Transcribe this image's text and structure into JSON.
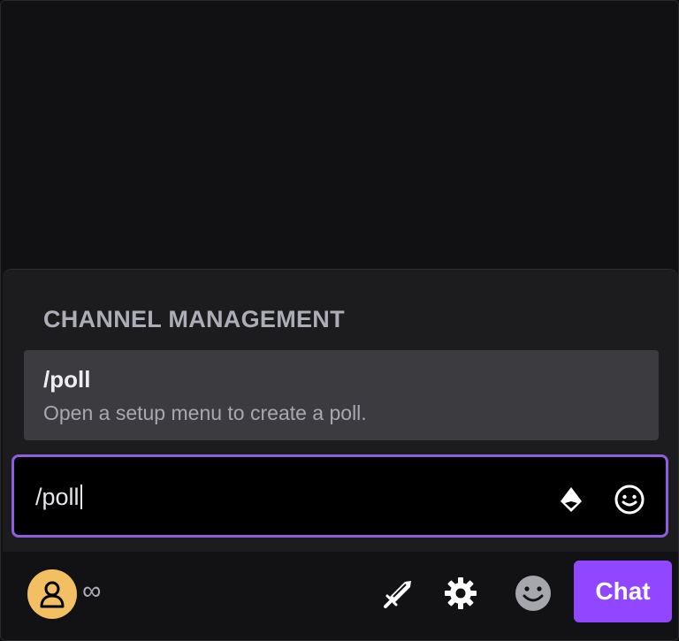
{
  "suggestions": {
    "section_title": "CHANNEL MANAGEMENT",
    "items": [
      {
        "command": "/poll",
        "description": "Open a setup menu to create a poll."
      }
    ]
  },
  "chat_input": {
    "value": "/poll",
    "icons": [
      "bits-icon",
      "emote-picker-icon"
    ]
  },
  "footer": {
    "points_symbol": "∞",
    "icons": [
      "sword-icon",
      "settings-gear-icon",
      "smiley-icon"
    ],
    "chat_button_label": "Chat"
  },
  "colors": {
    "accent": "#9147ff",
    "input_border": "#8f5ee0",
    "avatar_bg": "#f2c063",
    "panel_bg": "#1c1c1f",
    "suggestion_bg": "#3b3b40"
  }
}
